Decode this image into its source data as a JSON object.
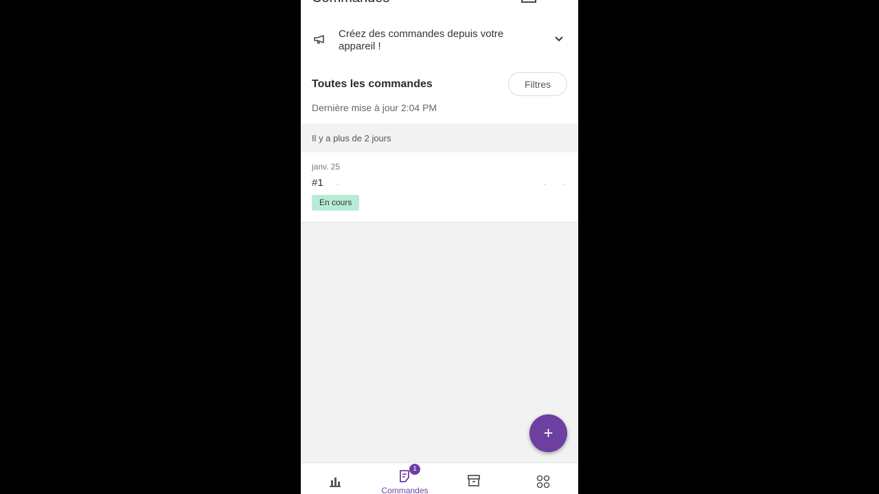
{
  "header": {
    "title": "Commandes"
  },
  "promo": {
    "text": "Créez des commandes depuis votre appareil !"
  },
  "orders": {
    "heading": "Toutes les commandes",
    "filters_label": "Filtres",
    "last_updated": "Dernière mise à jour 2:04 PM",
    "section_label": "Il y a plus de 2 jours",
    "items": [
      {
        "date": "janv. 25",
        "number": "#1",
        "status": "En cours"
      }
    ]
  },
  "fab": {
    "icon": "plus-icon",
    "label": "+"
  },
  "bottom_nav": {
    "items": [
      {
        "icon": "bar-chart-icon",
        "label": ""
      },
      {
        "icon": "orders-icon",
        "label": "Commandes",
        "badge": "1"
      },
      {
        "icon": "archive-icon",
        "label": ""
      },
      {
        "icon": "apps-grid-icon",
        "label": ""
      }
    ]
  },
  "colors": {
    "accent": "#6c3fa0",
    "status_bg": "#b8ebd6",
    "background": "#f2f2f2"
  }
}
